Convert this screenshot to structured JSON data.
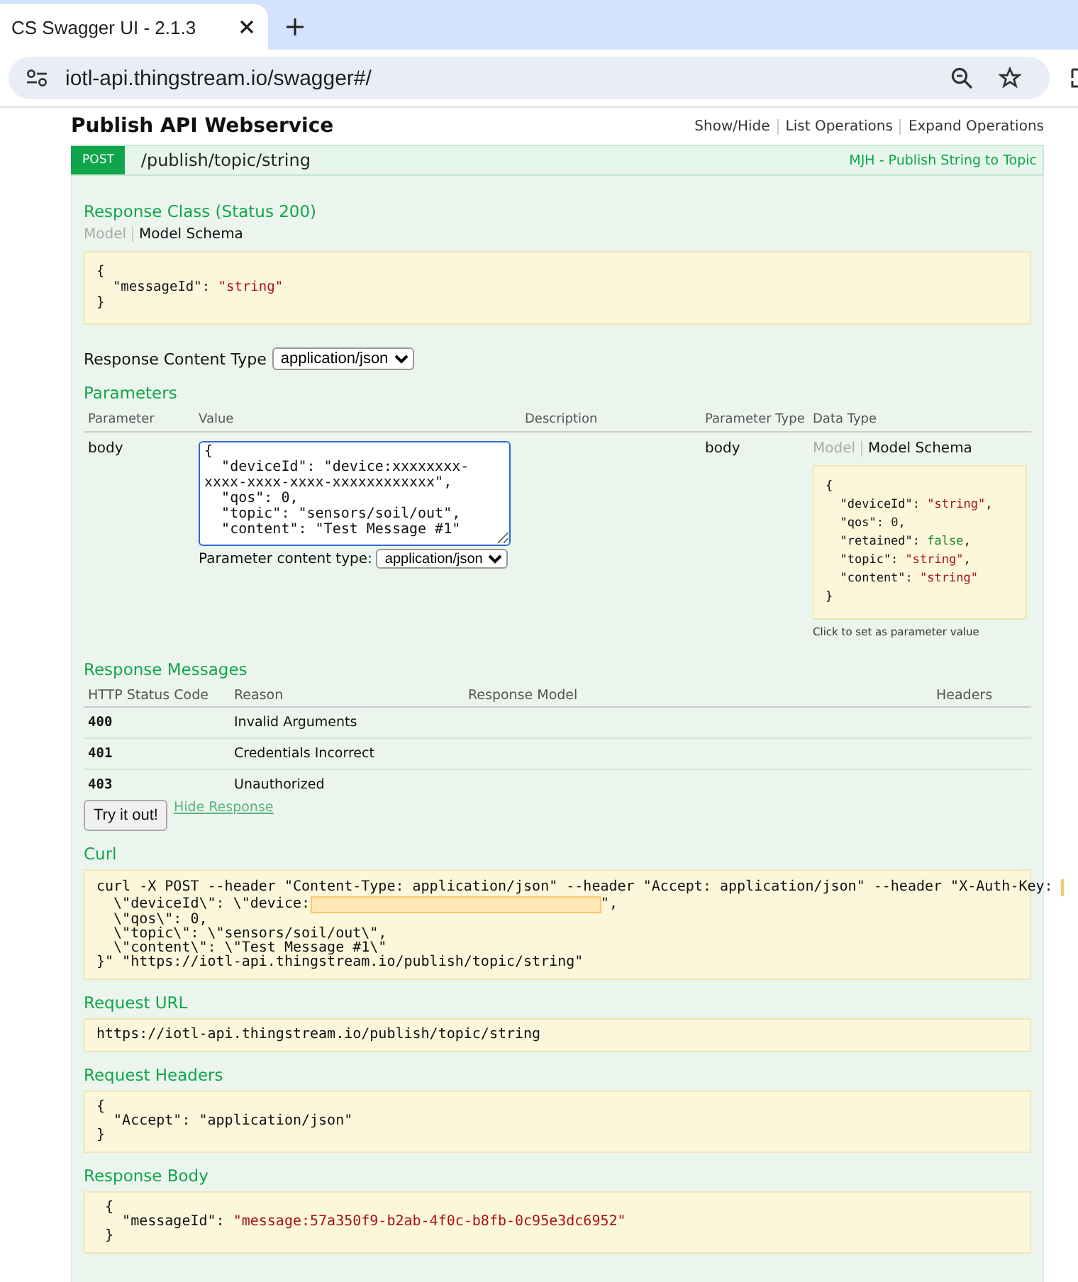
{
  "browser": {
    "tab_title": "CS Swagger UI - 2.1.3",
    "address": "iotl-api.thingstream.io/swagger#/"
  },
  "resource": {
    "title": "Publish API Webservice",
    "links": [
      "Show/Hide",
      "List Operations",
      "Expand Operations"
    ]
  },
  "operation": {
    "method": "POST",
    "path": "/publish/topic/string",
    "summary": "MJH - Publish String to Topic",
    "response_class": {
      "heading": "Response Class (Status 200)",
      "tabs": [
        {
          "label": "Model",
          "selected": false
        },
        {
          "label": "Model Schema",
          "selected": true
        }
      ],
      "code": [
        [
          {
            "text": "{",
            "kind": "plain"
          }
        ],
        [
          {
            "text": "  \"messageId\": ",
            "kind": "plain"
          },
          {
            "text": "\"string\"",
            "kind": "string"
          }
        ],
        [
          {
            "text": "}",
            "kind": "plain"
          }
        ]
      ]
    },
    "response_content_type": {
      "label": "Response Content Type",
      "value": "application/json"
    },
    "parameters": {
      "heading": "Parameters",
      "columns": [
        "Parameter",
        "Value",
        "Description",
        "Parameter Type",
        "Data Type"
      ],
      "rows": [
        {
          "name": "body",
          "value": "{\n  \"deviceId\": \"device:xxxxxxxx-xxxx-xxxx-xxxx-xxxxxxxxxxxx\",\n  \"qos\": 0,\n  \"topic\": \"sensors/soil/out\",\n  \"content\": \"Test Message #1\"",
          "content_type_label": "Parameter content type:",
          "content_type": "application/json",
          "param_type": "body",
          "data_type": {
            "tabs": [
              {
                "label": "Model",
                "selected": false
              },
              {
                "label": "Model Schema",
                "selected": true
              }
            ],
            "code": [
              [
                {
                  "text": "{",
                  "kind": "plain"
                }
              ],
              [
                {
                  "text": "  \"deviceId\": ",
                  "kind": "plain"
                },
                {
                  "text": "\"string\"",
                  "kind": "string"
                },
                {
                  "text": ",",
                  "kind": "plain"
                }
              ],
              [
                {
                  "text": "  \"qos\": ",
                  "kind": "plain"
                },
                {
                  "text": "0",
                  "kind": "number"
                },
                {
                  "text": ",",
                  "kind": "plain"
                }
              ],
              [
                {
                  "text": "  \"retained\": ",
                  "kind": "plain"
                },
                {
                  "text": "false",
                  "kind": "boolean"
                },
                {
                  "text": ",",
                  "kind": "plain"
                }
              ],
              [
                {
                  "text": "  \"topic\": ",
                  "kind": "plain"
                },
                {
                  "text": "\"string\"",
                  "kind": "string"
                },
                {
                  "text": ",",
                  "kind": "plain"
                }
              ],
              [
                {
                  "text": "  \"content\": ",
                  "kind": "plain"
                },
                {
                  "text": "\"string\"",
                  "kind": "string"
                }
              ],
              [
                {
                  "text": "}",
                  "kind": "plain"
                }
              ]
            ],
            "hint": "Click to set as parameter value"
          }
        }
      ]
    },
    "response_messages": {
      "heading": "Response Messages",
      "columns": [
        "HTTP Status Code",
        "Reason",
        "Response Model",
        "Headers"
      ],
      "rows": [
        {
          "code": "400",
          "reason": "Invalid Arguments"
        },
        {
          "code": "401",
          "reason": "Credentials Incorrect"
        },
        {
          "code": "403",
          "reason": "Unauthorized"
        }
      ]
    },
    "try_button": "Try it out!",
    "hide_link": "Hide Response",
    "results": [
      {
        "heading": "Curl",
        "code": [
          [
            {
              "text": "curl -X POST --header \"Content-Type: application/json\" --header \"Accept: application/json\" --header \"X-Auth-Key: ",
              "kind": "plain"
            },
            {
              "kind": "redaction"
            }
          ],
          [
            {
              "text": "  \\\"deviceId\\\": \\\"device:",
              "kind": "plain"
            },
            {
              "kind": "redaction"
            },
            {
              "text": "\",",
              "kind": "plain"
            }
          ],
          [
            {
              "text": "  \\\"qos\\\": 0,",
              "kind": "plain"
            }
          ],
          [
            {
              "text": "  \\\"topic\\\": \\\"sensors/soil/out\\\",",
              "kind": "plain"
            }
          ],
          [
            {
              "text": "  \\\"content\\\": \\\"Test Message #1\\\"",
              "kind": "plain"
            }
          ],
          [
            {
              "text": "}\" \"https://iotl-api.thingstream.io/publish/topic/string\"",
              "kind": "plain"
            }
          ]
        ]
      },
      {
        "heading": "Request URL",
        "code": [
          [
            {
              "text": "https://iotl-api.thingstream.io/publish/topic/string",
              "kind": "plain"
            }
          ]
        ]
      },
      {
        "heading": "Request Headers",
        "code": [
          [
            {
              "text": "{",
              "kind": "plain"
            }
          ],
          [
            {
              "text": "  \"Accept\": \"application/json\"",
              "kind": "plain"
            }
          ],
          [
            {
              "text": "}",
              "kind": "plain"
            }
          ]
        ]
      },
      {
        "heading": "Response Body",
        "code": [
          [
            {
              "text": " {",
              "kind": "plain"
            }
          ],
          [
            {
              "text": "   \"messageId\": ",
              "kind": "plain"
            },
            {
              "text": "\"message:57a350f9-b2ab-4f0c-b8fb-0c95e3dc6952\"",
              "kind": "string"
            }
          ],
          [
            {
              "text": " }",
              "kind": "plain"
            }
          ]
        ]
      }
    ]
  }
}
